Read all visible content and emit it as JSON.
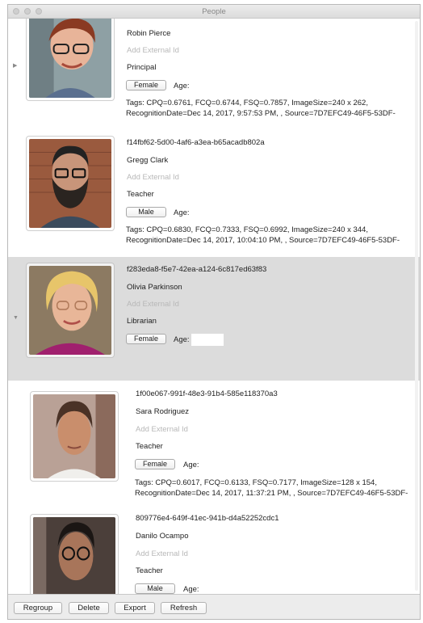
{
  "window": {
    "title": "People"
  },
  "people": [
    {
      "id": "",
      "name": "Robin Pierce",
      "external_id_placeholder": "Add External Id",
      "role": "Principal",
      "gender": "Female",
      "age_label": "Age:",
      "tags_line1": "Tags: CPQ=0.6761, FCQ=0.6744, FSQ=0.7857, ImageSize=240 x 262,",
      "tags_line2": "RecognitionDate=Dec 14, 2017, 9:57:53 PM, , Source=7D7EFC49-46F5-53DF-"
    },
    {
      "id": "f14fbf62-5d00-4af6-a3ea-b65acadb802a",
      "name": "Gregg Clark",
      "external_id_placeholder": "Add External Id",
      "role": "Teacher",
      "gender": "Male",
      "age_label": "Age:",
      "tags_line1": "Tags: CPQ=0.6830, FCQ=0.7333, FSQ=0.6992, ImageSize=240 x 344,",
      "tags_line2": "RecognitionDate=Dec 14, 2017, 10:04:10 PM, , Source=7D7EFC49-46F5-53DF-"
    },
    {
      "id": "f283eda8-f5e7-42ea-a124-6c817ed63f83",
      "name": "Olivia Parkinson",
      "external_id_placeholder": "Add External Id",
      "role": "Librarian",
      "gender": "Female",
      "age_label": "Age:"
    },
    {
      "id": "1f00e067-991f-48e3-91b4-585e118370a3",
      "name": "Sara Rodriguez",
      "external_id_placeholder": "Add External Id",
      "role": "Teacher",
      "gender": "Female",
      "age_label": "Age:",
      "tags_line1": "Tags: CPQ=0.6017, FCQ=0.6133, FSQ=0.7177, ImageSize=128 x 154,",
      "tags_line2": "RecognitionDate=Dec 14, 2017, 11:37:21 PM, , Source=7D7EFC49-46F5-53DF-"
    },
    {
      "id": "809776e4-649f-41ec-941b-d4a52252cdc1",
      "name": "Danilo Ocampo",
      "external_id_placeholder": "Add External Id",
      "role": "Teacher",
      "gender": "Male",
      "age_label": "Age:"
    }
  ],
  "footer": {
    "regroup": "Regroup",
    "delete": "Delete",
    "export": "Export",
    "refresh": "Refresh"
  },
  "icons": {
    "collapsed": "disclosure-right-icon",
    "expanded": "disclosure-down-icon"
  },
  "colors": {
    "selected_row": "#dcdcdc",
    "placeholder_text": "#b8b8b8"
  }
}
